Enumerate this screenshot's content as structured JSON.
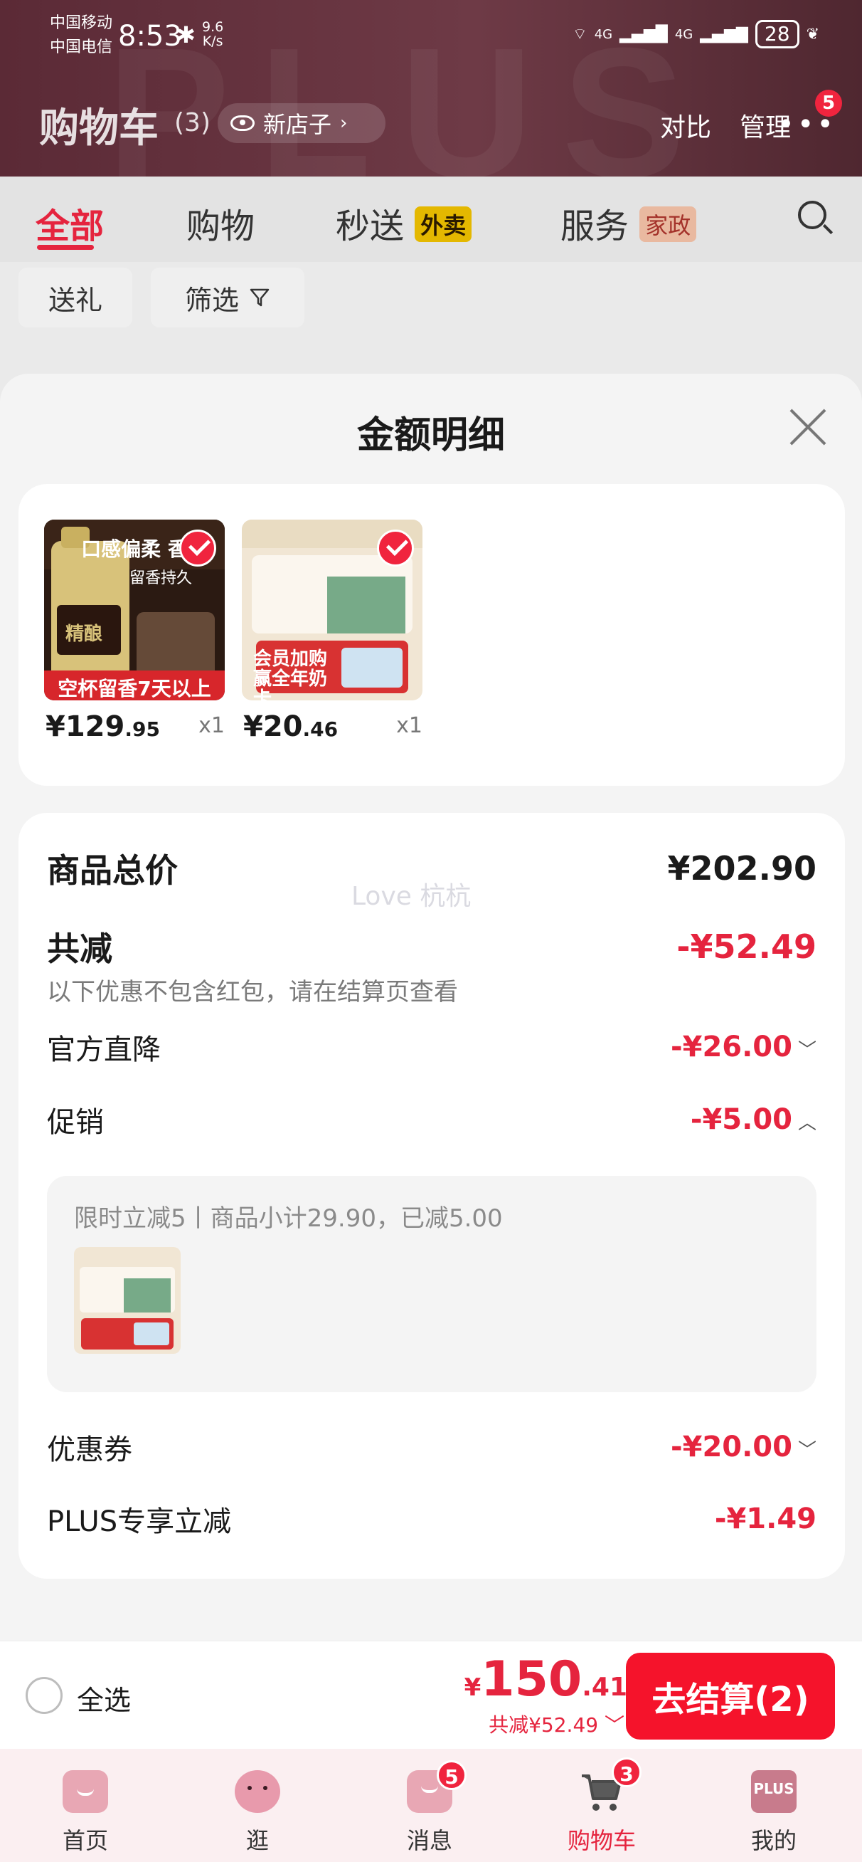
{
  "status_bar": {
    "carrier1": "中国移动",
    "carrier2": "中国电信",
    "time": "8:53",
    "net_speed_value": "9.6",
    "net_speed_unit": "K/s",
    "signal1": "4G",
    "signal2": "4G",
    "battery": "28"
  },
  "header": {
    "title": "购物车",
    "count": "(3)",
    "store_label": "新店子",
    "compare": "对比",
    "manage": "管理",
    "more_badge": "5"
  },
  "tabs": [
    {
      "label": "全部"
    },
    {
      "label": "购物"
    },
    {
      "label": "秒送",
      "tag": "外卖"
    },
    {
      "label": "服务",
      "tag": "家政"
    }
  ],
  "filters": {
    "gift": "送礼",
    "filter": "筛选"
  },
  "sheet": {
    "title": "金额明细",
    "products": [
      {
        "price_int": "¥129",
        "price_dec": ".95",
        "qty": "x1",
        "img_banner": "空杯留香7天以上",
        "img_text1": "口感偏柔 香",
        "img_text2": "留香持久",
        "img_label": "精酿"
      },
      {
        "price_int": "¥20",
        "price_dec": ".46",
        "qty": "x1",
        "img_banner": "会员加购赢全年奶卡"
      }
    ],
    "total_label": "商品总价",
    "total_value": "¥202.90",
    "watermark": "Love 杭杭",
    "discount_label": "共减",
    "discount_value": "-¥52.49",
    "discount_note": "以下优惠不包含红包，请在结算页查看",
    "official_label": "官方直降",
    "official_value": "-¥26.00",
    "promo_label": "促销",
    "promo_value": "-¥5.00",
    "promo_detail": "限时立减5丨商品小计29.90，已减5.00",
    "coupon_label": "优惠券",
    "coupon_value": "-¥20.00",
    "plus_label": "PLUS专享立减",
    "plus_value": "-¥1.49"
  },
  "checkout": {
    "select_all": "全选",
    "total_sym": "¥",
    "total_int": "150",
    "total_dec": ".41",
    "saved": "共减¥52.49",
    "button": "去结算(2)"
  },
  "bottom_nav": [
    {
      "label": "首页"
    },
    {
      "label": "逛"
    },
    {
      "label": "消息",
      "badge": "5"
    },
    {
      "label": "购物车",
      "badge": "3"
    },
    {
      "label": "我的",
      "icon_text": "PLUS"
    }
  ],
  "colors": {
    "accent_red": "#e5243e",
    "button_red": "#f5132b",
    "header_bg": "#5b2a36"
  }
}
